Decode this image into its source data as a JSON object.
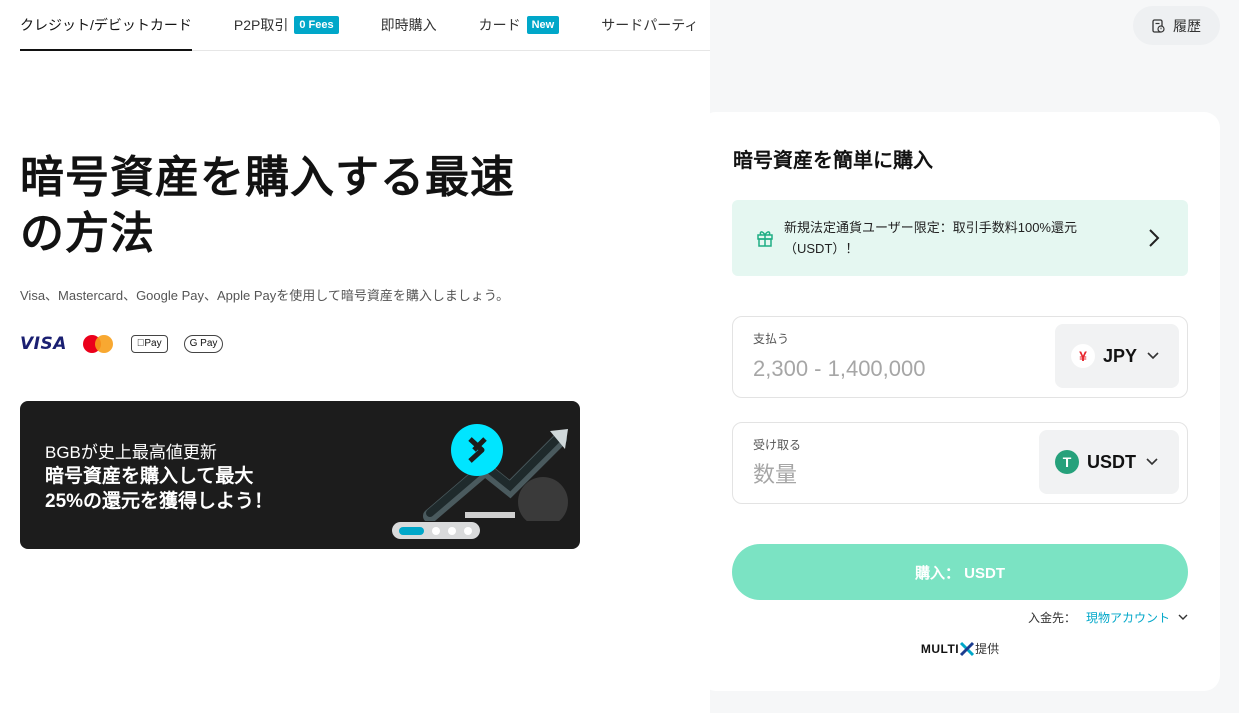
{
  "tabs": [
    {
      "label": "クレジット/デビットカード",
      "tag": ""
    },
    {
      "label": "P2P取引",
      "tag": "0 Fees"
    },
    {
      "label": "即時購入",
      "tag": ""
    },
    {
      "label": "カード",
      "tag": "New"
    },
    {
      "label": "サードパーティ",
      "tag": ""
    }
  ],
  "history_label": "履歴",
  "hero": {
    "title_line1": "暗号資産を購入する最速",
    "title_line2": "の方法",
    "subtitle": "Visa、Mastercard、Google Pay、Apple Payを使用して暗号資産を購入しましょう。",
    "logos": {
      "visa": "VISA",
      "apple_pay": "Pay",
      "google_pay": "G Pay"
    }
  },
  "banner": {
    "line1": "BGBが史上最高値更新",
    "line2": "暗号資産を購入して最大",
    "line3": "25%の還元を獲得しよう！",
    "active_slide": 1,
    "slide_count": 4
  },
  "panel": {
    "title": "暗号資産を簡単に購入",
    "promo_text": "新規法定通貨ユーザー限定：取引手数料100%還元（USDT）！",
    "pay": {
      "label": "支払う",
      "placeholder": "2,300 - 1,400,000",
      "currency": "JPY",
      "currency_symbol": "¥"
    },
    "receive": {
      "label": "受け取る",
      "placeholder": "数量",
      "currency": "USDT",
      "currency_symbol": "T"
    },
    "buy_button": "購入： USDT",
    "deposit_label": "入金先：",
    "deposit_account": "現物アカウント",
    "provider_name": "MULTI",
    "provider_suffix": "提供"
  },
  "colors": {
    "accent": "#00a7c9",
    "buy_button": "#7be3c3",
    "promo_bg": "#e5f7f1",
    "tether": "#26a17b",
    "yen": "#e8232b"
  }
}
